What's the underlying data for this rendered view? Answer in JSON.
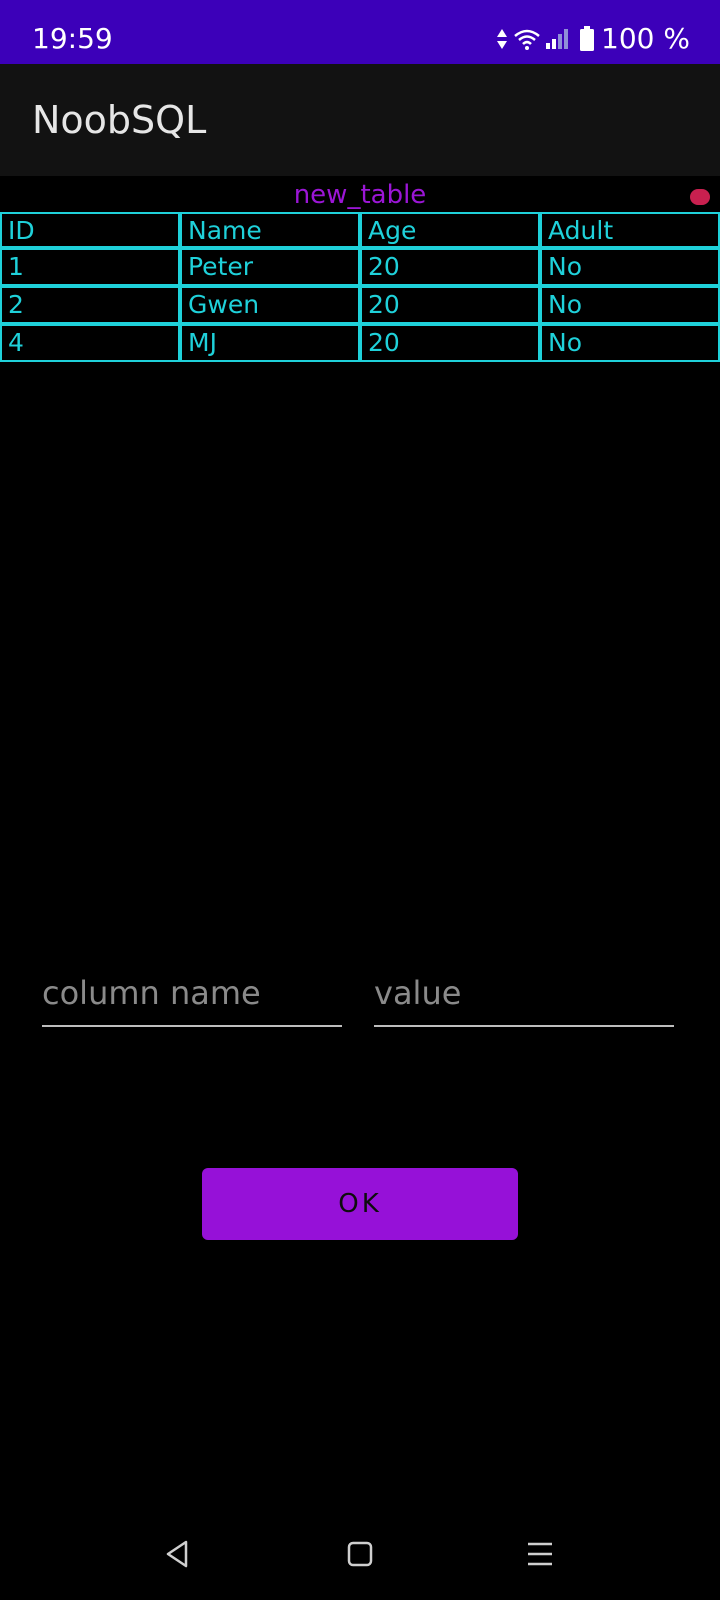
{
  "status_bar": {
    "time": "19:59",
    "battery": "100 %",
    "background": "#3c00b9"
  },
  "app_bar": {
    "title": "NoobSQL"
  },
  "table": {
    "name": "new_table",
    "columns": [
      "ID",
      "Name",
      "Age",
      "Adult"
    ],
    "rows": [
      [
        "1",
        "Peter",
        "20",
        "No"
      ],
      [
        "2",
        "Gwen",
        "20",
        "No"
      ],
      [
        "4",
        "MJ",
        "20",
        "No"
      ]
    ],
    "border_color": "#1fd1da"
  },
  "form": {
    "column_placeholder": "column name",
    "value_placeholder": "value",
    "ok_label": "OK",
    "accent": "#9611d8"
  },
  "nav": {
    "icons": [
      "back-icon",
      "home-icon",
      "menu-icon"
    ]
  }
}
